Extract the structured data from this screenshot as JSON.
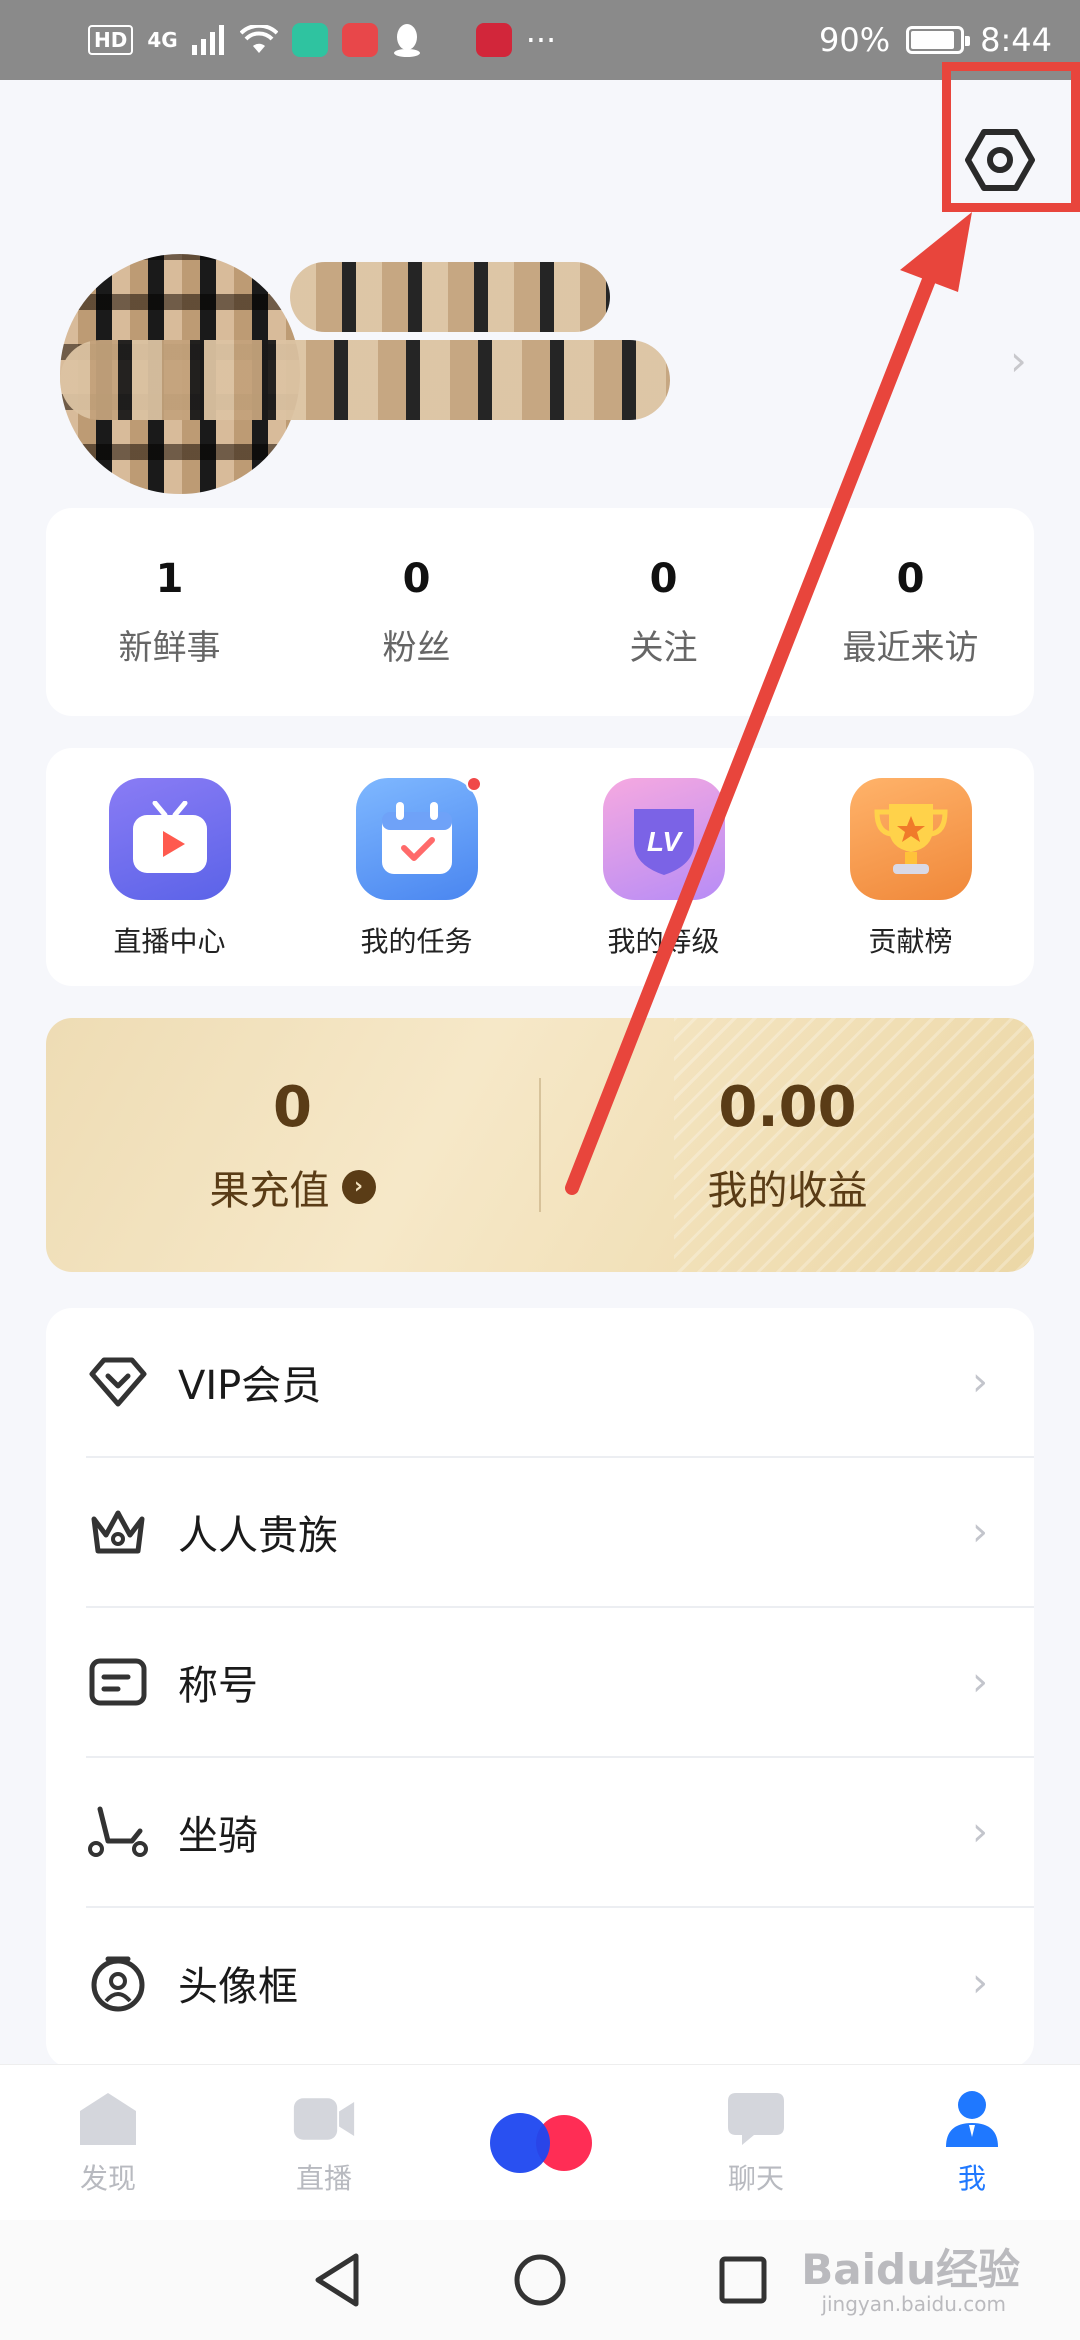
{
  "status_bar": {
    "network_chip": "HD",
    "network_type": "4G",
    "battery_percent": "90%",
    "battery_level": 0.9,
    "time": "8:44",
    "more": "···"
  },
  "profile": {
    "name_redacted": true
  },
  "stats": [
    {
      "value": "1",
      "label": "新鲜事"
    },
    {
      "value": "0",
      "label": "粉丝"
    },
    {
      "value": "0",
      "label": "关注"
    },
    {
      "value": "0",
      "label": "最近来访"
    }
  ],
  "shortcuts": [
    {
      "label": "直播中心",
      "icon": "live-tv-icon"
    },
    {
      "label": "我的任务",
      "icon": "calendar-task-icon",
      "badge": true
    },
    {
      "label": "我的等级",
      "icon": "level-shield-icon"
    },
    {
      "label": "贡献榜",
      "icon": "trophy-icon"
    }
  ],
  "wallet": {
    "recharge_value": "0",
    "recharge_label": "果充值",
    "earnings_value": "0.00",
    "earnings_label": "我的收益"
  },
  "menu": [
    {
      "label": "VIP会员",
      "icon": "diamond-icon"
    },
    {
      "label": "人人贵族",
      "icon": "crown-icon"
    },
    {
      "label": "称号",
      "icon": "title-badge-icon"
    },
    {
      "label": "坐骑",
      "icon": "scooter-icon"
    },
    {
      "label": "头像框",
      "icon": "avatar-frame-icon"
    }
  ],
  "bottom_nav": [
    {
      "label": "发现",
      "active": false
    },
    {
      "label": "直播",
      "active": false
    },
    {
      "label": "",
      "active": false
    },
    {
      "label": "聊天",
      "active": false
    },
    {
      "label": "我",
      "active": true
    }
  ],
  "watermark": {
    "text": "Baidu经验",
    "sub": "jingyan.baidu.com"
  },
  "colors": {
    "accent": "#1f78ff",
    "annotation": "#e8453c",
    "wallet_text": "#5a3c16"
  }
}
